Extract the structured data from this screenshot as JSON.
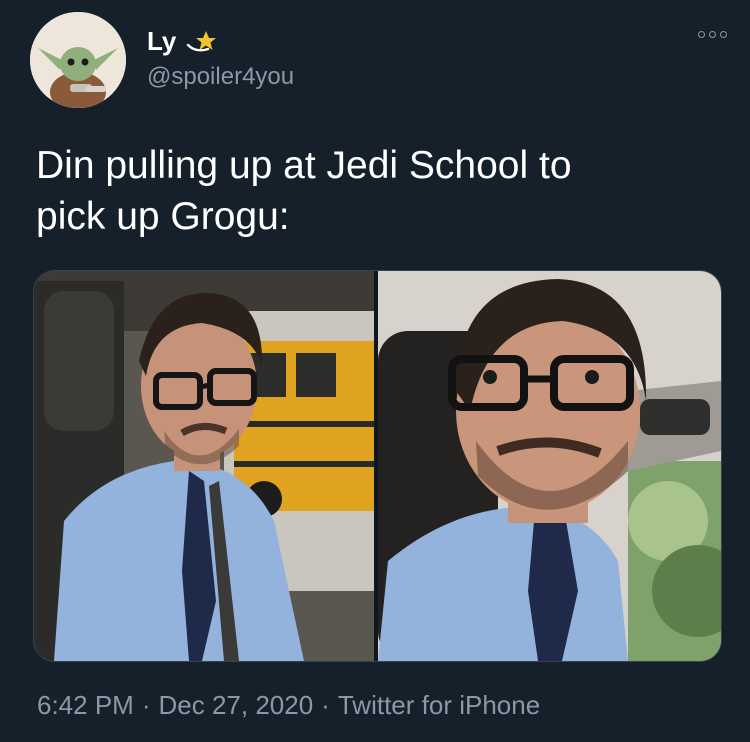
{
  "author": {
    "display_name": "Ly",
    "handle": "@spoiler4you",
    "avatar_icon": "baby-yoda-avatar",
    "badge_icon": "shooting-star-icon"
  },
  "tweet": {
    "text_line1": "Din pulling up at Jedi School to",
    "text_line2": "pick up Grogu:"
  },
  "media": {
    "left_panel": "man-in-glasses-driving-car-school-bus-outside",
    "right_panel": "man-in-glasses-looking-up-from-car-seat"
  },
  "meta": {
    "time": "6:42 PM",
    "separator": "·",
    "date": "Dec 27, 2020",
    "source": "Twitter for iPhone"
  },
  "colors": {
    "background": "#15202b",
    "secondary_text": "#8b98a5",
    "primary_text": "#ffffff",
    "bus_yellow": "#e1a01f",
    "shirt_blue": "#93b2dc"
  }
}
